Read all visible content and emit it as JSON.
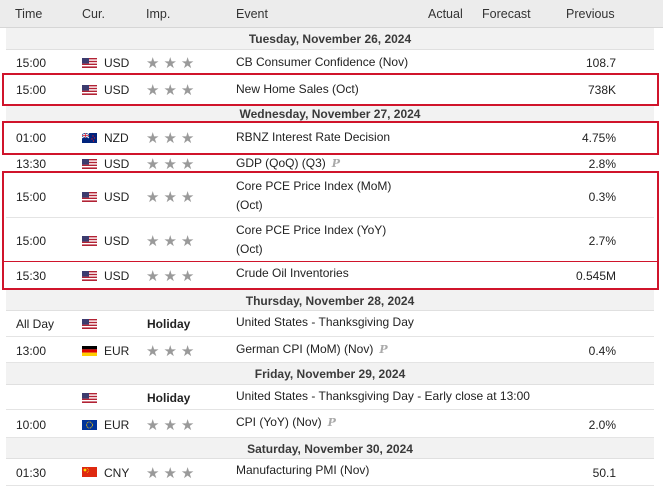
{
  "columns": {
    "time": "Time",
    "currency": "Cur.",
    "importance": "Imp.",
    "event": "Event",
    "actual": "Actual",
    "forecast": "Forecast",
    "previous": "Previous"
  },
  "dates": [
    "Tuesday, November 26, 2024",
    "Wednesday, November 27, 2024",
    "Thursday, November 28, 2024",
    "Friday, November 29, 2024",
    "Saturday, November 30, 2024"
  ],
  "events": [
    {
      "time": "15:00",
      "flag": "us-flag-icon",
      "currency": "USD",
      "importance": 3,
      "event": "CB Consumer Confidence (Nov)",
      "previous": "108.7"
    },
    {
      "time": "15:00",
      "flag": "us-flag-icon",
      "currency": "USD",
      "importance": 3,
      "event": "New Home Sales (Oct)",
      "previous": "738K"
    },
    {
      "time": "01:00",
      "flag": "nz-flag-icon",
      "currency": "NZD",
      "importance": 3,
      "event": "RBNZ Interest Rate Decision",
      "previous": "4.75%"
    },
    {
      "time": "13:30",
      "flag": "us-flag-icon",
      "currency": "USD",
      "importance": 3,
      "event": "GDP (QoQ) (Q3)",
      "preliminary": "P",
      "previous": "2.8%"
    },
    {
      "time": "15:00",
      "flag": "us-flag-icon",
      "currency": "USD",
      "importance": 3,
      "event": "Core PCE Price Index (MoM) (Oct)",
      "previous": "0.3%"
    },
    {
      "time": "15:00",
      "flag": "us-flag-icon",
      "currency": "USD",
      "importance": 3,
      "event": "Core PCE Price Index (YoY) (Oct)",
      "previous": "2.7%"
    },
    {
      "time": "15:30",
      "flag": "us-flag-icon",
      "currency": "USD",
      "importance": 3,
      "event": "Crude Oil Inventories",
      "previous": "0.545M"
    },
    {
      "time": "All Day",
      "flag": "us-flag-icon",
      "importance_label": "Holiday",
      "event": "United States - Thanksgiving Day"
    },
    {
      "time": "13:00",
      "flag": "de-flag-icon",
      "currency": "EUR",
      "importance": 3,
      "event": "German CPI (MoM) (Nov)",
      "preliminary": "P",
      "previous": "0.4%"
    },
    {
      "flag": "us-flag-icon",
      "importance_label": "Holiday",
      "event": "United States - Thanksgiving Day - Early close at 13:00"
    },
    {
      "time": "10:00",
      "flag": "eu-flag-icon",
      "currency": "EUR",
      "importance": 3,
      "event": "CPI (YoY) (Nov)",
      "preliminary": "P",
      "previous": "2.0%"
    },
    {
      "time": "01:30",
      "flag": "cn-flag-icon",
      "currency": "CNY",
      "importance": 3,
      "event": "Manufacturing PMI (Nov)",
      "previous": "50.1"
    }
  ],
  "colors": {
    "highlight": "#d0142b",
    "header_bg": "#ececec",
    "date_bg": "#f2f2f2",
    "star": "#9a9a9a"
  }
}
